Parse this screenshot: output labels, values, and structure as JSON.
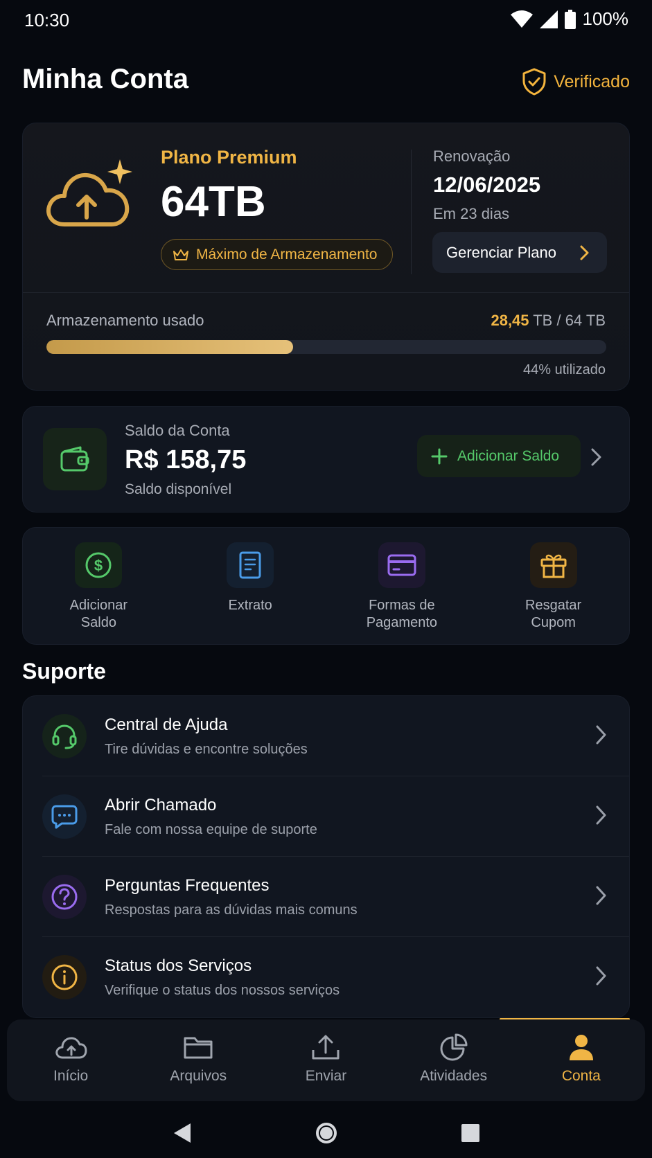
{
  "status_bar": {
    "time": "10:30",
    "battery": "100%"
  },
  "header": {
    "title": "Minha Conta",
    "verified_label": "Verificado"
  },
  "plan": {
    "name": "Plano Premium",
    "size": "64TB",
    "badge": "Máximo de Armazenamento",
    "renewal_label": "Renovação",
    "renewal_date": "12/06/2025",
    "renewal_days": "Em 23 dias",
    "manage_button": "Gerenciar Plano",
    "storage_label": "Armazenamento usado",
    "storage_used": "28,45",
    "storage_total": " TB / 64 TB",
    "storage_fraction": 0.44,
    "storage_percent_label": "44% utilizado"
  },
  "balance": {
    "label": "Saldo da Conta",
    "value": "R$ 158,75",
    "sub": "Saldo disponível",
    "add_button": "Adicionar Saldo"
  },
  "quick_actions": [
    {
      "label": "Adicionar\nSaldo",
      "icon": "dollar-circle-icon"
    },
    {
      "label": "Extrato",
      "icon": "receipt-icon"
    },
    {
      "label": "Formas de\nPagamento",
      "icon": "credit-card-icon"
    },
    {
      "label": "Resgatar\nCupom",
      "icon": "gift-icon"
    }
  ],
  "support": {
    "section_title": "Suporte",
    "items": [
      {
        "title": "Central de Ajuda",
        "subtitle": "Tire dúvidas e encontre soluções",
        "icon": "headset-icon"
      },
      {
        "title": "Abrir Chamado",
        "subtitle": "Fale com nossa equipe de suporte",
        "icon": "chat-icon"
      },
      {
        "title": "Perguntas Frequentes",
        "subtitle": "Respostas para as dúvidas mais comuns",
        "icon": "question-icon"
      },
      {
        "title": "Status dos Serviços",
        "subtitle": "Verifique o status dos nossos serviços",
        "icon": "info-icon"
      }
    ]
  },
  "bottom_nav": [
    {
      "label": "Início",
      "icon": "cloud-upload-icon"
    },
    {
      "label": "Arquivos",
      "icon": "folder-icon"
    },
    {
      "label": "Enviar",
      "icon": "upload-icon"
    },
    {
      "label": "Atividades",
      "icon": "pie-chart-icon"
    },
    {
      "label": "Conta",
      "icon": "user-icon",
      "active": true
    }
  ],
  "colors": {
    "accent": "#f0b545",
    "green": "#55c96a",
    "blue": "#4a9be8",
    "purple": "#9a6cf0",
    "background": "#06090f"
  }
}
